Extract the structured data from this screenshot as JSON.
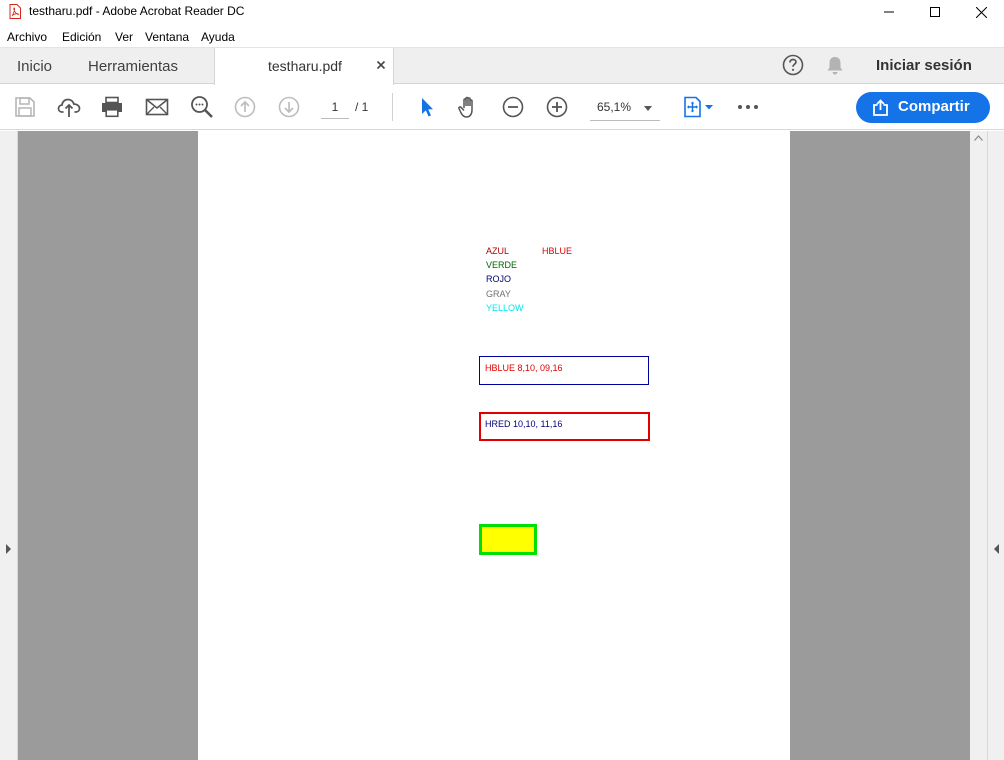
{
  "window": {
    "title": "testharu.pdf - Adobe Acrobat Reader DC"
  },
  "menu": {
    "items": [
      "Archivo",
      "Edición",
      "Ver",
      "Ventana",
      "Ayuda"
    ]
  },
  "tabs": {
    "home": "Inicio",
    "tools": "Herramientas",
    "document": "testharu.pdf"
  },
  "header": {
    "signin": "Iniciar sesión"
  },
  "toolbar": {
    "page_current": "1",
    "page_total": "/ 1",
    "zoom": "65,1%",
    "share_label": "Compartir"
  },
  "colors": {
    "accent": "#1473e6",
    "canvas_gray": "#9b9b9b"
  },
  "document": {
    "color_labels": [
      {
        "text": "AZUL",
        "color": "#b00000"
      },
      {
        "text": "VERDE",
        "color": "#006400"
      },
      {
        "text": "ROJO",
        "color": "#00007a"
      },
      {
        "text": "GRAY",
        "color": "#707070"
      },
      {
        "text": "YELLOW",
        "color": "#00e5ee"
      }
    ],
    "hblue_label": {
      "text": "HBLUE",
      "color": "#e00000"
    },
    "box_blue": {
      "text": "HBLUE 8,10, 09,16",
      "text_color": "#e00000",
      "border_color": "#00009c"
    },
    "box_red": {
      "text": "HRED 10,10, 11,16",
      "text_color": "#00007a",
      "border_color": "#e00000"
    },
    "box_yellow": {
      "fill": "#ffff00",
      "border_color": "#00e000"
    }
  }
}
